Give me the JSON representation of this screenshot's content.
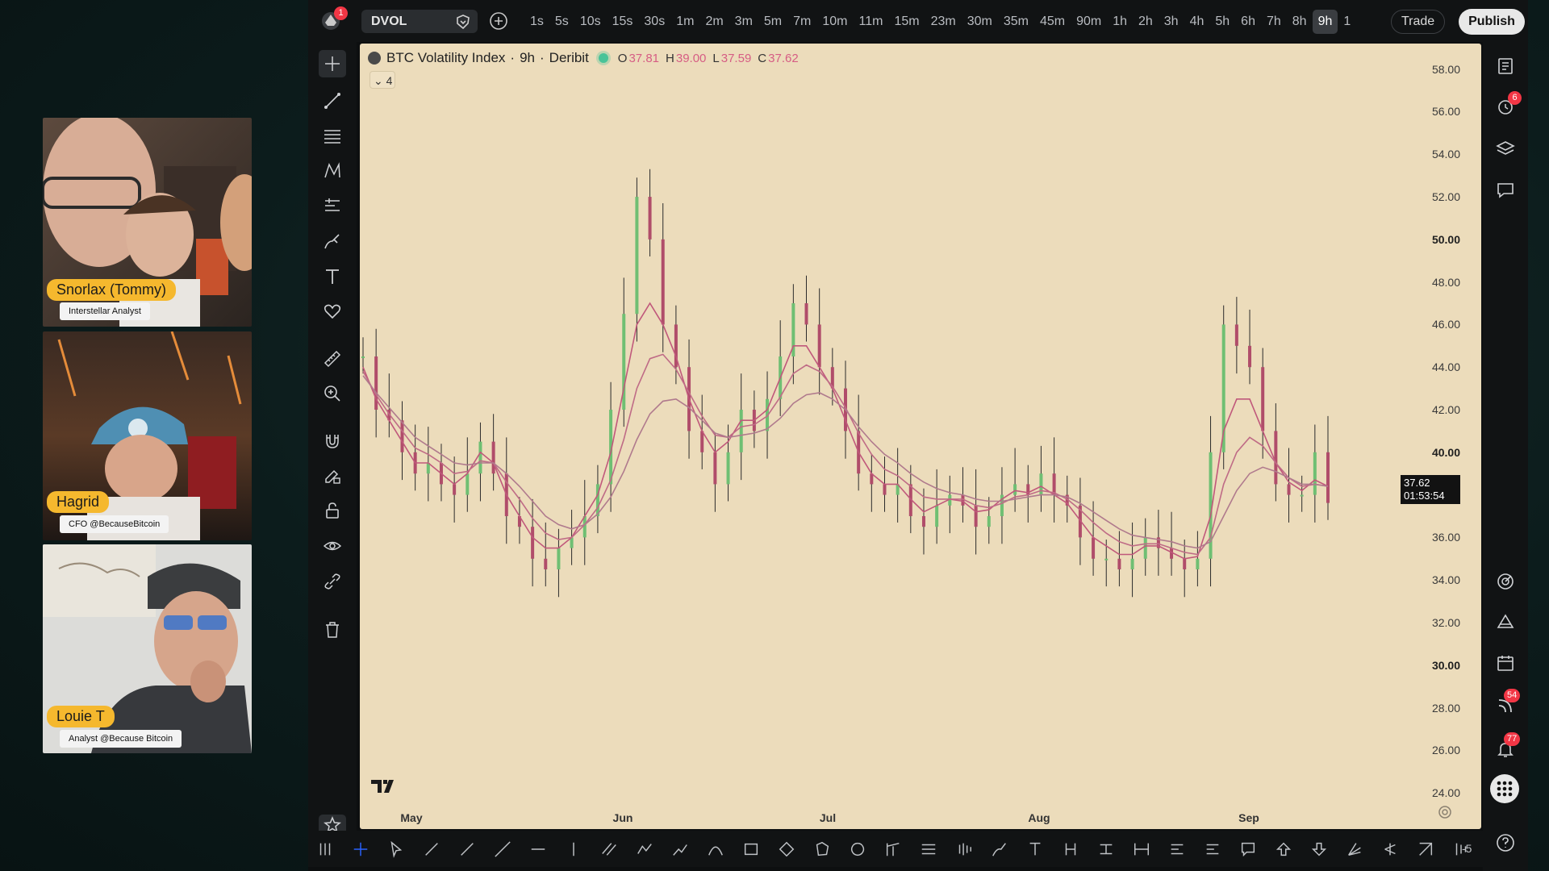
{
  "webcams": [
    {
      "name": "Snorlax (Tommy)",
      "role": "Interstellar Analyst"
    },
    {
      "name": "Hagrid",
      "role": "CFO @BecauseBitcoin"
    },
    {
      "name": "Louie T",
      "role": "Analyst @Because Bitcoin"
    }
  ],
  "topbar": {
    "notification_count": "1",
    "symbol": "DVOL",
    "timeframes": [
      "1s",
      "5s",
      "10s",
      "15s",
      "30s",
      "1m",
      "2m",
      "3m",
      "5m",
      "7m",
      "10m",
      "11m",
      "15m",
      "23m",
      "30m",
      "35m",
      "45m",
      "90m",
      "1h",
      "2h",
      "3h",
      "4h",
      "5h",
      "6h",
      "7h",
      "8h",
      "9h",
      "1"
    ],
    "active_timeframe": "9h",
    "trade_label": "Trade",
    "publish_label": "Publish"
  },
  "chart": {
    "symbol_name": "BTC Volatility Index",
    "interval": "9h",
    "exchange": "Deribit",
    "ohlc": {
      "open_label": "O",
      "open": "37.81",
      "high_label": "H",
      "high": "39.00",
      "low_label": "L",
      "low": "37.59",
      "close_label": "C",
      "close": "37.62"
    },
    "indicator_count": "4",
    "last_price": "37.62",
    "countdown": "01:53:54",
    "candle_up_color": "#6fbf73",
    "candle_down_color": "#b04d6a"
  },
  "chart_data": {
    "type": "line",
    "ylim": [
      22.3,
      59.2
    ],
    "y_ticks": [
      "58.00",
      "56.00",
      "54.00",
      "52.00",
      "50.00",
      "48.00",
      "46.00",
      "44.00",
      "42.00",
      "40.00",
      "38.00",
      "36.00",
      "34.00",
      "32.00",
      "30.00",
      "28.00",
      "26.00",
      "24.00"
    ],
    "x_ticks": [
      "May",
      "Jun",
      "Jul",
      "Aug",
      "Sep"
    ],
    "series": [
      {
        "values": [
          44.5,
          42,
          41.5,
          40,
          39,
          39.5,
          38.5,
          38,
          39,
          40.5,
          39,
          37,
          36.5,
          35,
          34.5,
          35.5,
          36,
          37,
          38.5,
          42,
          46.5,
          52,
          50,
          46,
          44,
          41,
          40,
          38.5,
          40,
          42,
          41,
          42.5,
          44.5,
          47,
          46,
          44,
          43,
          41,
          39,
          38.5,
          38,
          38.5,
          37,
          36.5,
          37.5,
          38,
          37.5,
          36.5,
          37,
          38,
          38.5,
          38,
          39,
          38,
          37.5,
          36,
          35,
          35,
          34.5,
          35,
          36,
          35.5,
          35,
          34.5,
          35,
          40,
          46,
          45,
          44,
          41,
          38.5,
          38,
          38,
          40,
          37.62
        ]
      },
      {
        "values": [
          44,
          42.5,
          41.5,
          40.5,
          39.5,
          39.5,
          39,
          38.5,
          39,
          40,
          39.5,
          38,
          37,
          36,
          35.5,
          35.5,
          36,
          37,
          38,
          40,
          43,
          46,
          47,
          46,
          44.5,
          42.5,
          41,
          40,
          40.5,
          41.5,
          41.5,
          42,
          43.5,
          45,
          45,
          44,
          43,
          41.5,
          40,
          39,
          38.5,
          38.5,
          37.8,
          37.2,
          37.5,
          37.8,
          37.7,
          37.2,
          37.3,
          37.8,
          38.2,
          38.1,
          38.4,
          38,
          37.6,
          36.8,
          36,
          35.6,
          35.2,
          35.2,
          35.6,
          35.6,
          35.3,
          35,
          35.1,
          37,
          41,
          42.5,
          42.5,
          41,
          39.5,
          38.6,
          38.2,
          38.7,
          38.4
        ]
      },
      {
        "values": [
          43.8,
          42.7,
          41.8,
          41,
          40.2,
          39.9,
          39.5,
          39,
          39.1,
          39.6,
          39.5,
          38.6,
          37.8,
          36.9,
          36.2,
          35.9,
          36,
          36.6,
          37.4,
          38.7,
          40.6,
          43,
          44.4,
          44.6,
          43.9,
          42.8,
          41.7,
          40.8,
          40.7,
          41.2,
          41.3,
          41.7,
          42.6,
          43.7,
          44.1,
          43.8,
          43.1,
          42.1,
          40.9,
          39.9,
          39.2,
          38.9,
          38.4,
          37.9,
          37.8,
          37.8,
          37.8,
          37.5,
          37.4,
          37.6,
          37.9,
          38,
          38.2,
          38.1,
          37.8,
          37.3,
          36.7,
          36.2,
          35.8,
          35.6,
          35.7,
          35.7,
          35.5,
          35.3,
          35.2,
          36,
          38.5,
          40,
          40.7,
          40.3,
          39.5,
          38.8,
          38.4,
          38.5,
          38.4
        ]
      },
      {
        "values": [
          43.6,
          42.8,
          42.1,
          41.4,
          40.7,
          40.3,
          39.9,
          39.5,
          39.4,
          39.5,
          39.5,
          39,
          38.4,
          37.7,
          37,
          36.6,
          36.4,
          36.6,
          37.1,
          37.9,
          39.1,
          40.6,
          41.8,
          42.4,
          42.5,
          42.1,
          41.5,
          40.9,
          40.7,
          40.8,
          40.9,
          41.1,
          41.6,
          42.3,
          42.7,
          42.8,
          42.5,
          42,
          41.2,
          40.5,
          39.9,
          39.5,
          39,
          38.6,
          38.3,
          38.1,
          38,
          37.8,
          37.7,
          37.7,
          37.8,
          37.9,
          38,
          38,
          37.9,
          37.6,
          37.2,
          36.8,
          36.4,
          36.1,
          36,
          35.9,
          35.8,
          35.6,
          35.5,
          35.8,
          37,
          38.2,
          39,
          39.3,
          39.1,
          38.8,
          38.5,
          38.5,
          38.4
        ]
      }
    ]
  },
  "left_tools": [
    "crosshair-icon",
    "trend-line-icon",
    "fib-lines-icon",
    "pattern-icon",
    "forecast-icon",
    "brush-icon",
    "text-icon",
    "heart-icon",
    "ruler-icon",
    "zoom-in-icon",
    "magnet-icon",
    "lock-pencil-icon",
    "lock-icon",
    "eye-icon",
    "link-icon",
    "trash-icon",
    "star-icon"
  ],
  "right_tools": {
    "alerts_count": "6",
    "news_count": "54",
    "notifications_count": "77"
  },
  "bottom_tools": {
    "end_label": "-5"
  }
}
